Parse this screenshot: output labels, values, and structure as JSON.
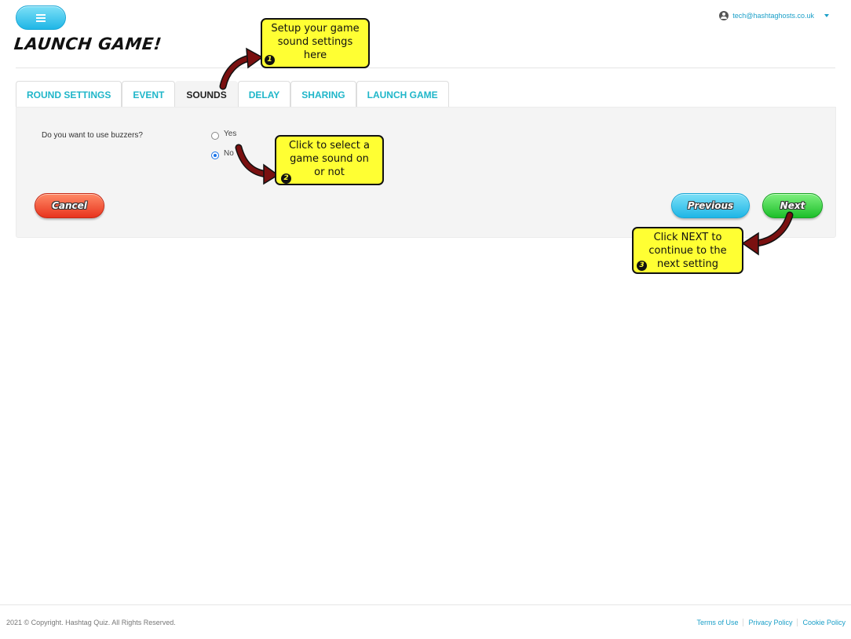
{
  "header": {
    "menu_icon": "hamburger-icon",
    "title": "LAUNCH GAME!",
    "user": {
      "email": "tech@hashtaghosts.co.uk",
      "icon": "user-circle-icon"
    }
  },
  "tabs": [
    {
      "label": "ROUND SETTINGS",
      "active": false
    },
    {
      "label": "EVENT",
      "active": false
    },
    {
      "label": "SOUNDS",
      "active": true
    },
    {
      "label": "DELAY",
      "active": false
    },
    {
      "label": "SHARING",
      "active": false
    },
    {
      "label": "LAUNCH GAME",
      "active": false
    }
  ],
  "form": {
    "question": "Do you want to use buzzers?",
    "options": [
      {
        "label": "Yes",
        "checked": false
      },
      {
        "label": "No",
        "checked": true
      }
    ]
  },
  "buttons": {
    "cancel": "Cancel",
    "previous": "Previous",
    "next": "Next"
  },
  "callouts": [
    {
      "number": "1",
      "lines": [
        "Setup your game",
        "sound settings",
        "here"
      ]
    },
    {
      "number": "2",
      "lines": [
        "Click to select a",
        "game sound on",
        "or not"
      ]
    },
    {
      "number": "3",
      "lines": [
        "Click NEXT to",
        "continue to the",
        "next setting"
      ]
    }
  ],
  "footer": {
    "copyright": "2021 © Copyright. Hashtag Quiz. All Rights Reserved.",
    "links": [
      "Terms of Use",
      "Privacy Policy",
      "Cookie Policy"
    ]
  },
  "colors": {
    "accent": "#1fb6c9",
    "callout": "#ffff33",
    "arrow": "#7a1010",
    "cancel": "#e8341e",
    "previous": "#1fb6e6",
    "next": "#1cbf2a"
  }
}
